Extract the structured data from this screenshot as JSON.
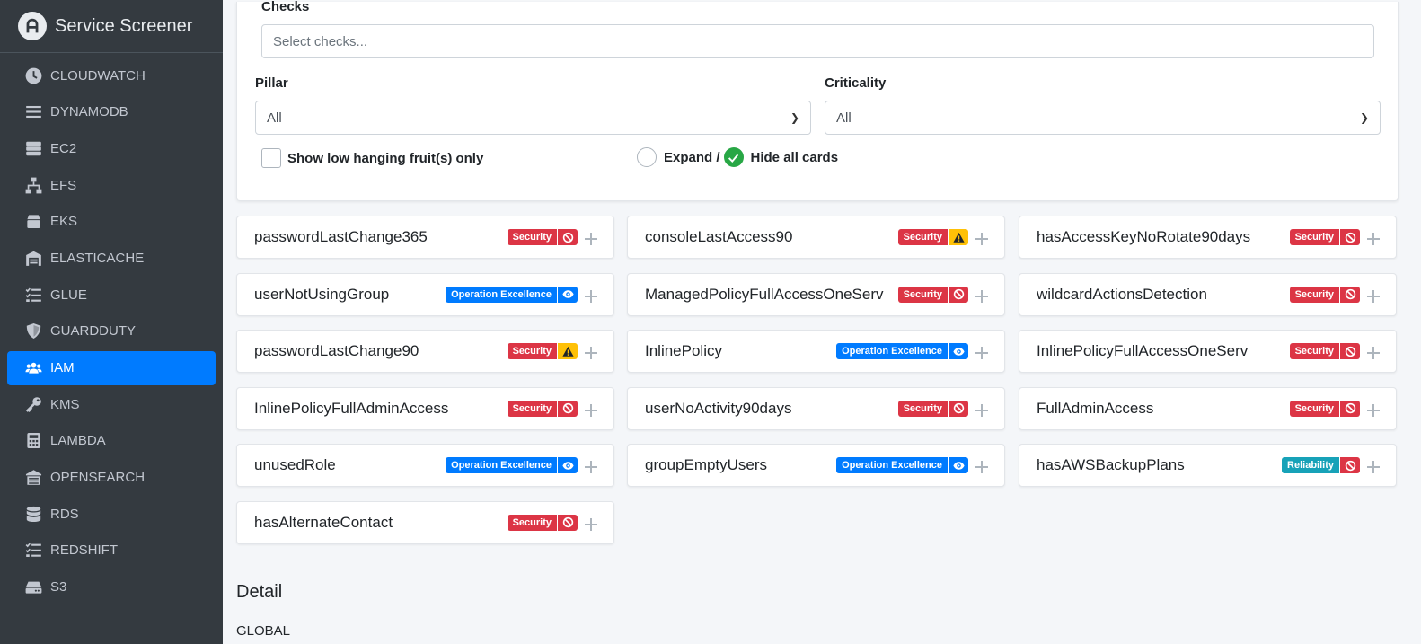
{
  "app": {
    "title": "Service Screener"
  },
  "sidebar": {
    "items": [
      {
        "label": "CLOUDWATCH",
        "icon": "clock-icon"
      },
      {
        "label": "DYNAMODB",
        "icon": "bars-icon"
      },
      {
        "label": "EC2",
        "icon": "server-icon"
      },
      {
        "label": "EFS",
        "icon": "network-icon"
      },
      {
        "label": "EKS",
        "icon": "box-icon"
      },
      {
        "label": "ELASTICACHE",
        "icon": "warehouse-icon"
      },
      {
        "label": "GLUE",
        "icon": "list-check-icon"
      },
      {
        "label": "GUARDDUTY",
        "icon": "shield-icon"
      },
      {
        "label": "IAM",
        "icon": "users-icon",
        "active": true
      },
      {
        "label": "KMS",
        "icon": "key-icon"
      },
      {
        "label": "LAMBDA",
        "icon": "calculator-icon"
      },
      {
        "label": "OPENSEARCH",
        "icon": "building-icon"
      },
      {
        "label": "RDS",
        "icon": "database-icon"
      },
      {
        "label": "REDSHIFT",
        "icon": "list-check-icon"
      },
      {
        "label": "S3",
        "icon": "hdd-icon"
      }
    ]
  },
  "filters": {
    "checks_label": "Checks",
    "checks_placeholder": "Select checks...",
    "pillar_label": "Pillar",
    "pillar_value": "All",
    "criticality_label": "Criticality",
    "criticality_value": "All",
    "lhf_label": "Show low hanging fruit(s) only",
    "expand_label": "Expand /",
    "hide_label": "Hide all cards"
  },
  "colors": {
    "security": "#dc3545",
    "operation_excellence": "#007bff",
    "reliability": "#17a2b8",
    "warning": "#ffc107",
    "active_nav": "#007bff",
    "sidebar_bg": "#343a40"
  },
  "cards": [
    {
      "title": "passwordLastChange365",
      "pillar": "Security",
      "severity": "high"
    },
    {
      "title": "consoleLastAccess90",
      "pillar": "Security",
      "severity": "medium"
    },
    {
      "title": "hasAccessKeyNoRotate90days",
      "pillar": "Security",
      "severity": "high"
    },
    {
      "title": "userNotUsingGroup",
      "pillar": "Operation Excellence",
      "severity": "info"
    },
    {
      "title": "ManagedPolicyFullAccessOneServ",
      "pillar": "Security",
      "severity": "high"
    },
    {
      "title": "wildcardActionsDetection",
      "pillar": "Security",
      "severity": "high"
    },
    {
      "title": "passwordLastChange90",
      "pillar": "Security",
      "severity": "medium"
    },
    {
      "title": "InlinePolicy",
      "pillar": "Operation Excellence",
      "severity": "info"
    },
    {
      "title": "InlinePolicyFullAccessOneServ",
      "pillar": "Security",
      "severity": "high"
    },
    {
      "title": "InlinePolicyFullAdminAccess",
      "pillar": "Security",
      "severity": "high"
    },
    {
      "title": "userNoActivity90days",
      "pillar": "Security",
      "severity": "high"
    },
    {
      "title": "FullAdminAccess",
      "pillar": "Security",
      "severity": "high"
    },
    {
      "title": "unusedRole",
      "pillar": "Operation Excellence",
      "severity": "info"
    },
    {
      "title": "groupEmptyUsers",
      "pillar": "Operation Excellence",
      "severity": "info"
    },
    {
      "title": "hasAWSBackupPlans",
      "pillar": "Reliability",
      "severity": "high"
    },
    {
      "title": "hasAlternateContact",
      "pillar": "Security",
      "severity": "high"
    }
  ],
  "detail": {
    "title": "Detail",
    "region": "GLOBAL"
  }
}
